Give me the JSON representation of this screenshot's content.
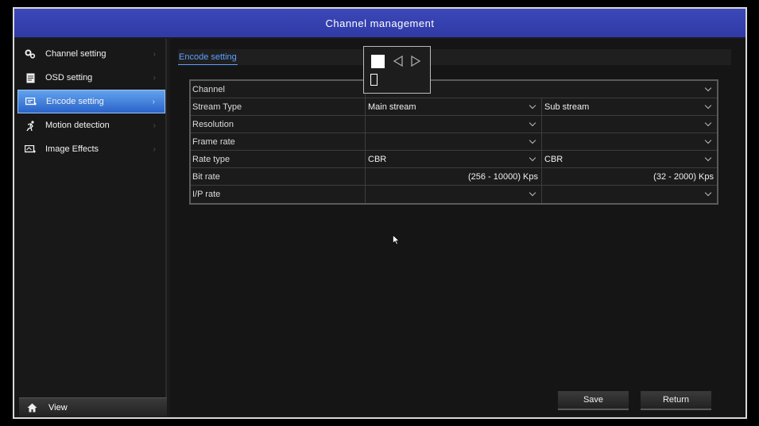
{
  "title": "Channel management",
  "sidebar": {
    "items": [
      {
        "label": "Channel setting",
        "icon": "gears-icon"
      },
      {
        "label": "OSD setting",
        "icon": "document-icon"
      },
      {
        "label": "Encode setting",
        "icon": "encode-icon",
        "active": true
      },
      {
        "label": "Motion detection",
        "icon": "running-person-icon"
      },
      {
        "label": "Image Effects",
        "icon": "image-effects-icon"
      }
    ],
    "view_label": "View"
  },
  "tab": "Encode setting",
  "table": {
    "rows": [
      {
        "label": "Channel",
        "main": "",
        "sub": ""
      },
      {
        "label": "Stream Type",
        "main": "Main stream",
        "sub": "Sub stream"
      },
      {
        "label": "Resolution",
        "main": "",
        "sub": ""
      },
      {
        "label": "Frame rate",
        "main": "",
        "sub": ""
      },
      {
        "label": "Rate type",
        "main": "CBR",
        "sub": "CBR"
      },
      {
        "label": "Bit rate",
        "main": "(256 - 10000) Kps",
        "sub": "(32 - 2000) Kps"
      },
      {
        "label": "I/P rate",
        "main": "",
        "sub": ""
      }
    ]
  },
  "buttons": {
    "save": "Save",
    "return": "Return"
  },
  "colors": {
    "titlebar": "#3340ad",
    "active_item": "#3f7fdb",
    "tab_accent": "#5fa0ff"
  }
}
